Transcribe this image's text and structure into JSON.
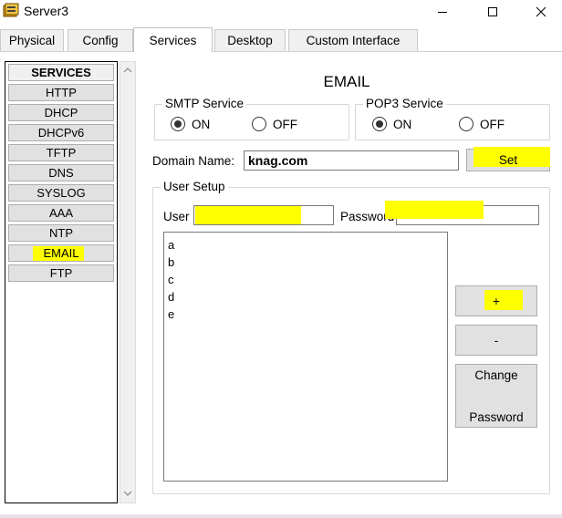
{
  "window": {
    "title": "Server3"
  },
  "tabs": [
    {
      "label": "Physical",
      "active": false
    },
    {
      "label": "Config",
      "active": false
    },
    {
      "label": "Services",
      "active": true
    },
    {
      "label": "Desktop",
      "active": false
    },
    {
      "label": "Custom Interface",
      "active": false
    }
  ],
  "sidebar": {
    "header": "SERVICES",
    "items": [
      {
        "label": "HTTP"
      },
      {
        "label": "DHCP"
      },
      {
        "label": "DHCPv6"
      },
      {
        "label": "TFTP"
      },
      {
        "label": "DNS"
      },
      {
        "label": "SYSLOG"
      },
      {
        "label": "AAA"
      },
      {
        "label": "NTP"
      },
      {
        "label": "EMAIL",
        "selected": true
      },
      {
        "label": "FTP"
      }
    ]
  },
  "email": {
    "title": "EMAIL",
    "smtp": {
      "label": "SMTP Service",
      "on_label": "ON",
      "off_label": "OFF",
      "selected": "on"
    },
    "pop3": {
      "label": "POP3 Service",
      "on_label": "ON",
      "off_label": "OFF",
      "selected": "on"
    },
    "domain": {
      "label": "Domain Name:",
      "value": "knag.com",
      "set_label": "Set"
    },
    "user_setup": {
      "legend": "User Setup",
      "user_label": "User",
      "user_value": "",
      "password_label": "Password",
      "password_value": "",
      "users": [
        "a",
        "b",
        "c",
        "d",
        "e"
      ],
      "add_label": "+",
      "remove_label": "-",
      "change_password_line1": "Change",
      "change_password_line2": "Password"
    }
  },
  "colors": {
    "highlight": "#ffff00",
    "button_face": "#e1e1e1",
    "tab_inactive": "#f0f0f0"
  }
}
